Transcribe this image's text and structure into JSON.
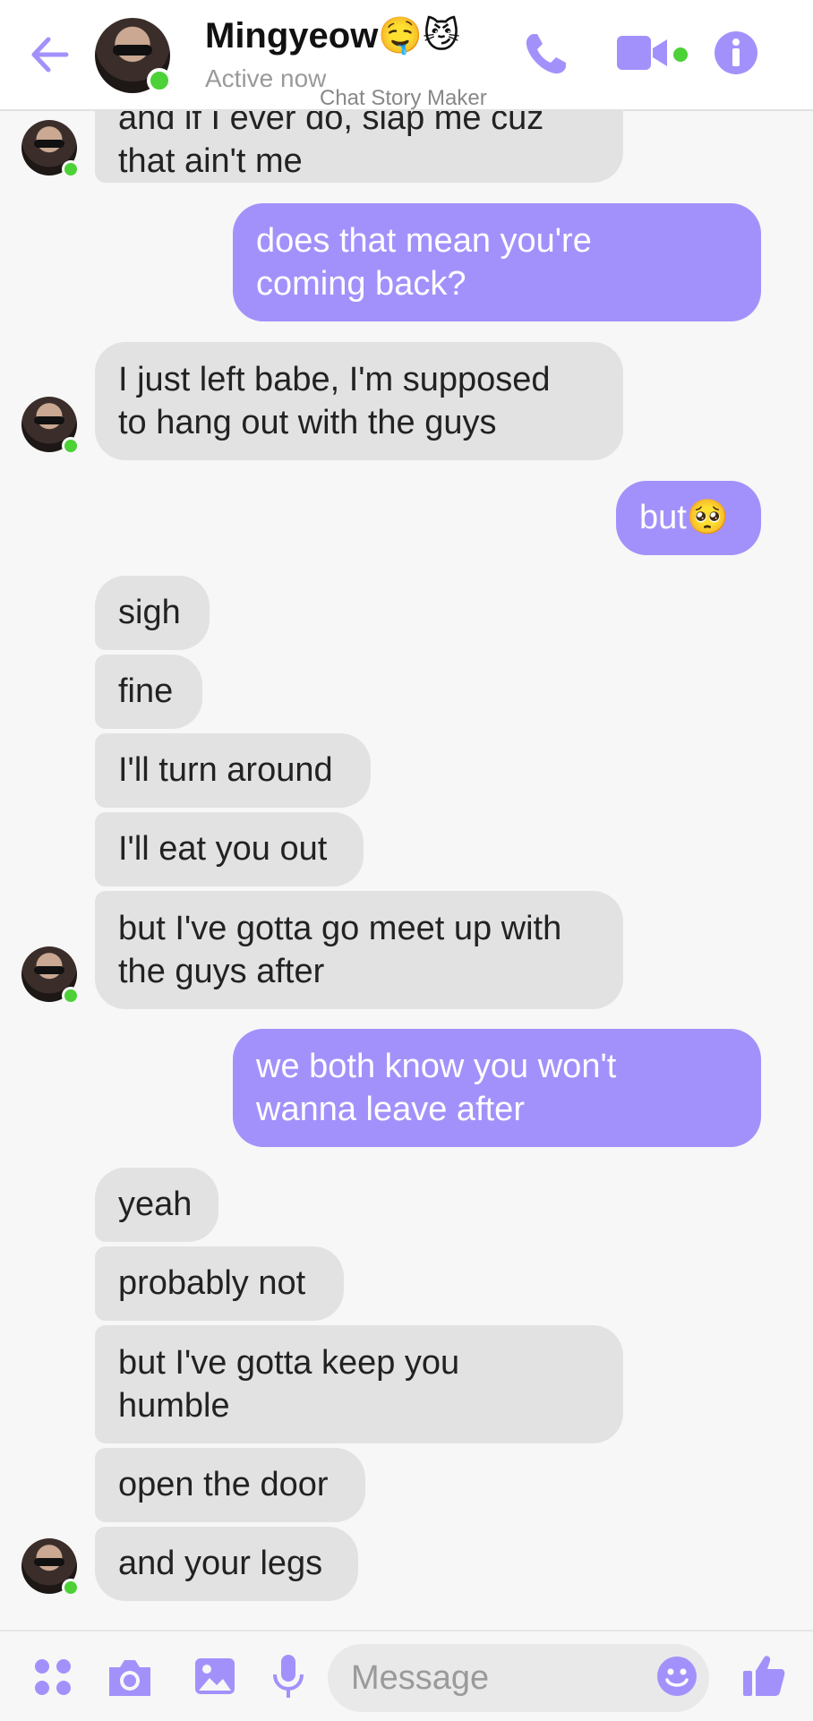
{
  "header": {
    "contact_name": "Mingyeow🤤😼",
    "status": "Active now",
    "watermark": "Chat Story Maker",
    "accent": "#a391fb",
    "online_color": "#4cd137"
  },
  "icons": {
    "back": "arrow-left",
    "call": "phone",
    "video": "video-camera",
    "info": "info-circle",
    "apps": "four-dots",
    "camera": "camera",
    "gallery": "image",
    "mic": "microphone",
    "emoji": "smiley",
    "like": "thumbs-up"
  },
  "messages": [
    {
      "from": "them",
      "text": "and if I ever do, slap me cuz\nthat ain't me"
    },
    {
      "from": "me",
      "text": "does that mean you're\ncoming back?"
    },
    {
      "from": "them",
      "text": "I just left babe, I'm supposed\nto hang out with the guys"
    },
    {
      "from": "me",
      "text": "but🥺"
    },
    {
      "from": "them",
      "text": "sigh"
    },
    {
      "from": "them",
      "text": "fine"
    },
    {
      "from": "them",
      "text": "I'll turn around"
    },
    {
      "from": "them",
      "text": "I'll eat you out"
    },
    {
      "from": "them",
      "text": "but I've gotta go meet up with\nthe guys after"
    },
    {
      "from": "me",
      "text": "we both know you won't\nwanna leave after"
    },
    {
      "from": "them",
      "text": "yeah"
    },
    {
      "from": "them",
      "text": "probably not"
    },
    {
      "from": "them",
      "text": "but I've gotta keep you\nhumble"
    },
    {
      "from": "them",
      "text": "open the door"
    },
    {
      "from": "them",
      "text": "and your legs"
    }
  ],
  "composer": {
    "placeholder": "Message"
  }
}
